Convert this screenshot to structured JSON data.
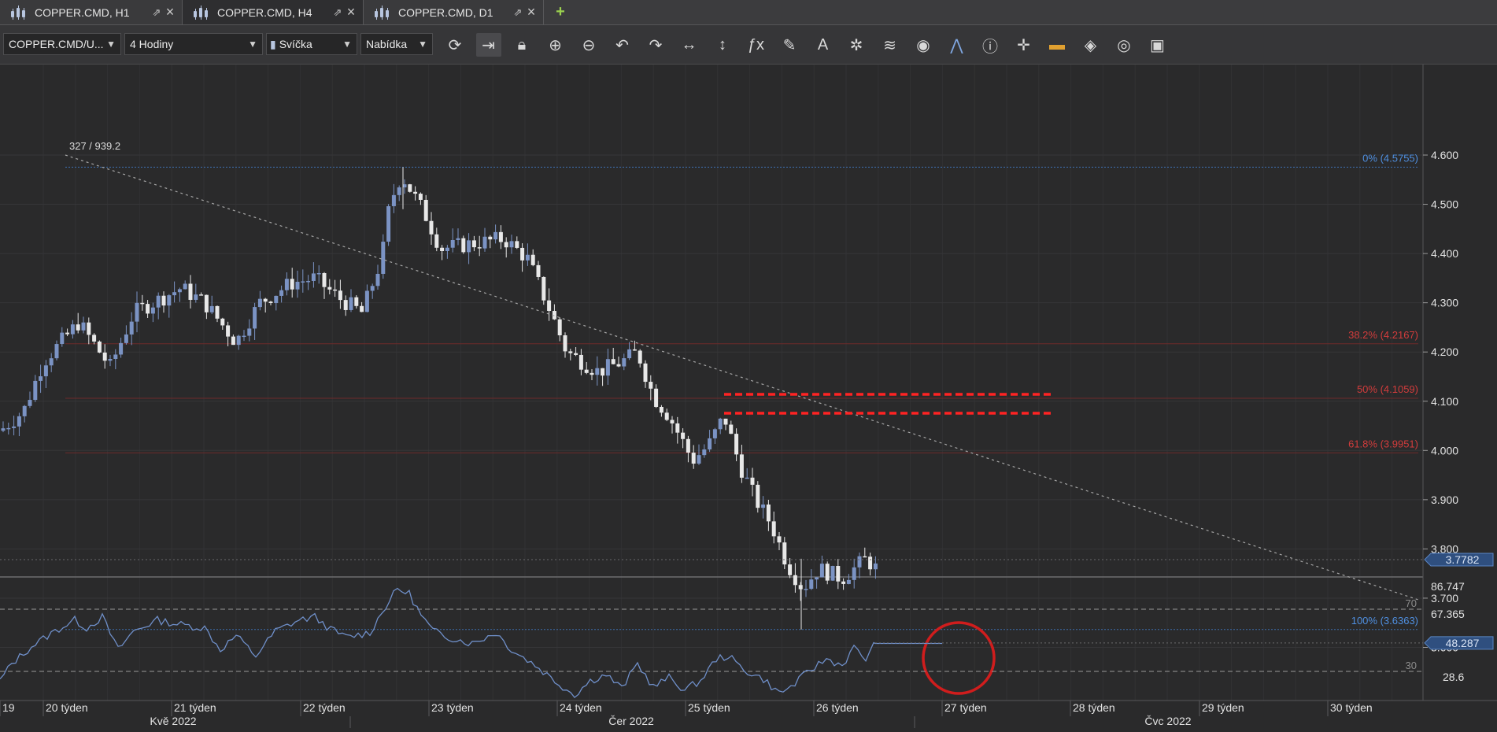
{
  "tabs": [
    {
      "label": "COPPER.CMD, H1",
      "active": false
    },
    {
      "label": "COPPER.CMD, H4",
      "active": true
    },
    {
      "label": "COPPER.CMD, D1",
      "active": false
    }
  ],
  "toolbar": {
    "instrument": "COPPER.CMD/U...",
    "period": "4 Hodiny",
    "chart_type": "Svíčka",
    "price_side": "Nabídka",
    "tools": [
      "refresh-icon",
      "shift-chart-icon",
      "lock-icon",
      "zoom-in-icon",
      "zoom-out-icon",
      "undo-icon",
      "redo-icon",
      "horizontal-fit-icon",
      "vertical-fit-icon",
      "fx-indicators-icon",
      "pencil-draw-icon",
      "text-tool-icon",
      "pattern-icon",
      "layers-icon",
      "eye-icon",
      "alert-signal-icon",
      "info-icon",
      "crosshair-icon",
      "color-palette-icon",
      "paint-bucket-icon",
      "settings-wheel-icon",
      "save-icon"
    ]
  },
  "chart": {
    "readout": "327 / 939.2",
    "price_ticks": [
      "4.600",
      "4.500",
      "4.400",
      "4.300",
      "4.200",
      "4.100",
      "4.000",
      "3.900",
      "3.800",
      "3.700",
      "3.600"
    ],
    "fib_levels": [
      {
        "label": "0% (4.5755)",
        "color": "#4f8fe0",
        "price": 4.5755
      },
      {
        "label": "38.2% (4.2167)",
        "color": "#d23c3c",
        "price": 4.2167
      },
      {
        "label": "50% (4.1059)",
        "color": "#d23c3c",
        "price": 4.1059
      },
      {
        "label": "61.8% (3.9951)",
        "color": "#d23c3c",
        "price": 3.9951
      },
      {
        "label": "100% (3.6363)",
        "color": "#4f8fe0",
        "price": 3.6363
      }
    ],
    "current_price": "3.7782",
    "rsi": {
      "scale_top": "86.747",
      "scale_upper": "67.365",
      "scale_lower": "28.6",
      "level_70": "70",
      "level_30": "30",
      "current": "48.287"
    },
    "week_labels": [
      "19",
      "20 týden",
      "21 týden",
      "22 týden",
      "23 týden",
      "24 týden",
      "25 týden",
      "26 týden",
      "27 týden",
      "28 týden",
      "29 týden",
      "30 týden"
    ],
    "month_labels": [
      "Kvě 2022",
      "Čer 2022",
      "Čvc 2022"
    ],
    "colors": {
      "bull": "#7b93c4",
      "bear": "#e8e8e8",
      "background": "#2a2a2b",
      "trendline": "#a0a0a0",
      "zone": "#ff2a2a",
      "circle": "#d01d1d"
    }
  }
}
